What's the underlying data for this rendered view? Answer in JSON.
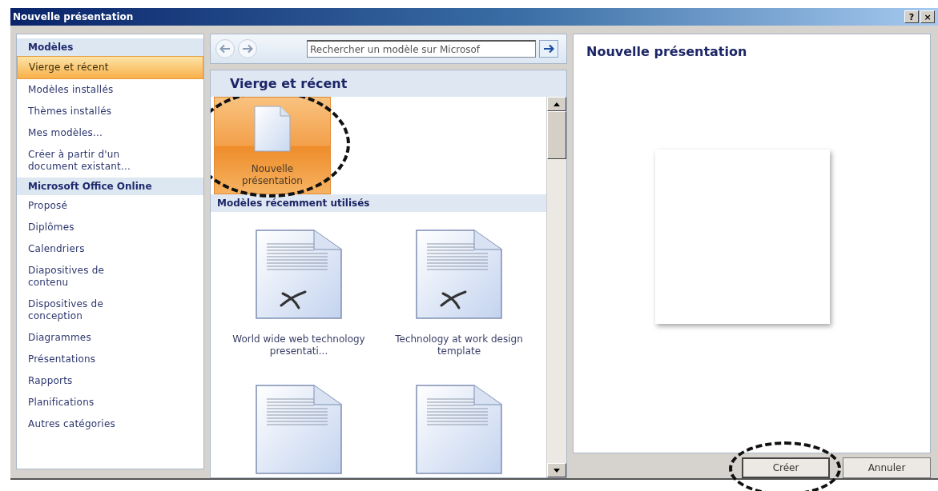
{
  "window": {
    "title": "Nouvelle présentation",
    "controls": [
      "?",
      "×"
    ]
  },
  "sidebar": {
    "items": [
      {
        "label": "Modèles",
        "kind": "header",
        "selected": false
      },
      {
        "label": "Vierge et récent",
        "kind": "item",
        "selected": true
      },
      {
        "label": "Modèles installés",
        "kind": "item",
        "selected": false
      },
      {
        "label": "Thèmes installés",
        "kind": "item",
        "selected": false
      },
      {
        "label": "Mes modèles...",
        "kind": "item",
        "selected": false
      },
      {
        "label": "Créer à partir d'un document existant...",
        "kind": "item",
        "selected": false
      },
      {
        "label": "Microsoft Office Online",
        "kind": "header",
        "selected": false
      },
      {
        "label": "Proposé",
        "kind": "item",
        "selected": false
      },
      {
        "label": "Diplômes",
        "kind": "item",
        "selected": false
      },
      {
        "label": "Calendriers",
        "kind": "item",
        "selected": false
      },
      {
        "label": "Diapositives de contenu",
        "kind": "item",
        "selected": false
      },
      {
        "label": "Dispositives de conception",
        "kind": "item",
        "selected": false
      },
      {
        "label": "Diagrammes",
        "kind": "item",
        "selected": false
      },
      {
        "label": "Présentations",
        "kind": "item",
        "selected": false
      },
      {
        "label": "Rapports",
        "kind": "item",
        "selected": false
      },
      {
        "label": "Planifications",
        "kind": "item",
        "selected": false
      },
      {
        "label": "Autres catégories",
        "kind": "item",
        "selected": false
      }
    ]
  },
  "search": {
    "placeholder": "Rechercher un modèle sur Microsof"
  },
  "gallery": {
    "title": "Vierge et récent",
    "featured": {
      "label": "Nouvelle présentation",
      "selected": true,
      "circled": true
    },
    "recent_title": "Modèles récemment utilisés",
    "templates": [
      {
        "label": "World wide web technology presentati...",
        "kind": "marked"
      },
      {
        "label": "Technology at work design template",
        "kind": "marked"
      },
      {
        "kind": "plain"
      },
      {
        "kind": "plain"
      }
    ]
  },
  "preview": {
    "title": "Nouvelle présentation"
  },
  "buttons": [
    {
      "label": "Créer",
      "circled": true
    },
    {
      "label": "Annuler",
      "circled": false
    }
  ]
}
